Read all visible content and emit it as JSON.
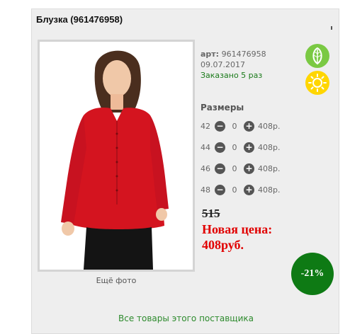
{
  "product": {
    "title": "Блузка (961476958)",
    "art_label": "арт:",
    "art_value": "961476958",
    "date": "09.07.2017",
    "ordered": "Заказано 5 раз",
    "more_photo": "Ещё фото"
  },
  "badges": {
    "leaf_icon": "leaf-icon",
    "sun_icon": "sun-icon",
    "leaf_color": "#7ac943",
    "sun_color": "#ffd600"
  },
  "sizes": {
    "heading": "Размеры",
    "rows": [
      {
        "size": "42",
        "qty": "0",
        "price": "408р."
      },
      {
        "size": "44",
        "qty": "0",
        "price": "408р."
      },
      {
        "size": "46",
        "qty": "0",
        "price": "408р."
      },
      {
        "size": "48",
        "qty": "0",
        "price": "408р."
      }
    ]
  },
  "pricing": {
    "old_price": "515",
    "new_price_label": "Новая цена:",
    "new_price": "408руб.",
    "discount": "-21%",
    "new_price_color": "#e10000",
    "discount_color": "#0e7a14"
  },
  "footer": {
    "supplier_link": "Все товары этого поставщика"
  }
}
